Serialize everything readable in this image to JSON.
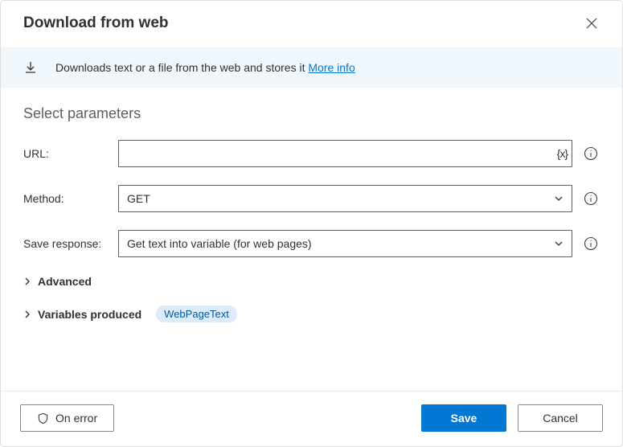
{
  "header": {
    "title": "Download from web"
  },
  "banner": {
    "text": "Downloads text or a file from the web and stores it ",
    "link": "More info"
  },
  "section": {
    "title": "Select parameters"
  },
  "fields": {
    "url": {
      "label": "URL:",
      "value": "",
      "var_btn": "{x}"
    },
    "method": {
      "label": "Method:",
      "value": "GET"
    },
    "save_response": {
      "label": "Save response:",
      "value": "Get text into variable (for web pages)"
    }
  },
  "expanders": {
    "advanced": "Advanced",
    "variables_produced": "Variables produced",
    "variable_chip": "WebPageText"
  },
  "footer": {
    "on_error": "On error",
    "save": "Save",
    "cancel": "Cancel"
  }
}
